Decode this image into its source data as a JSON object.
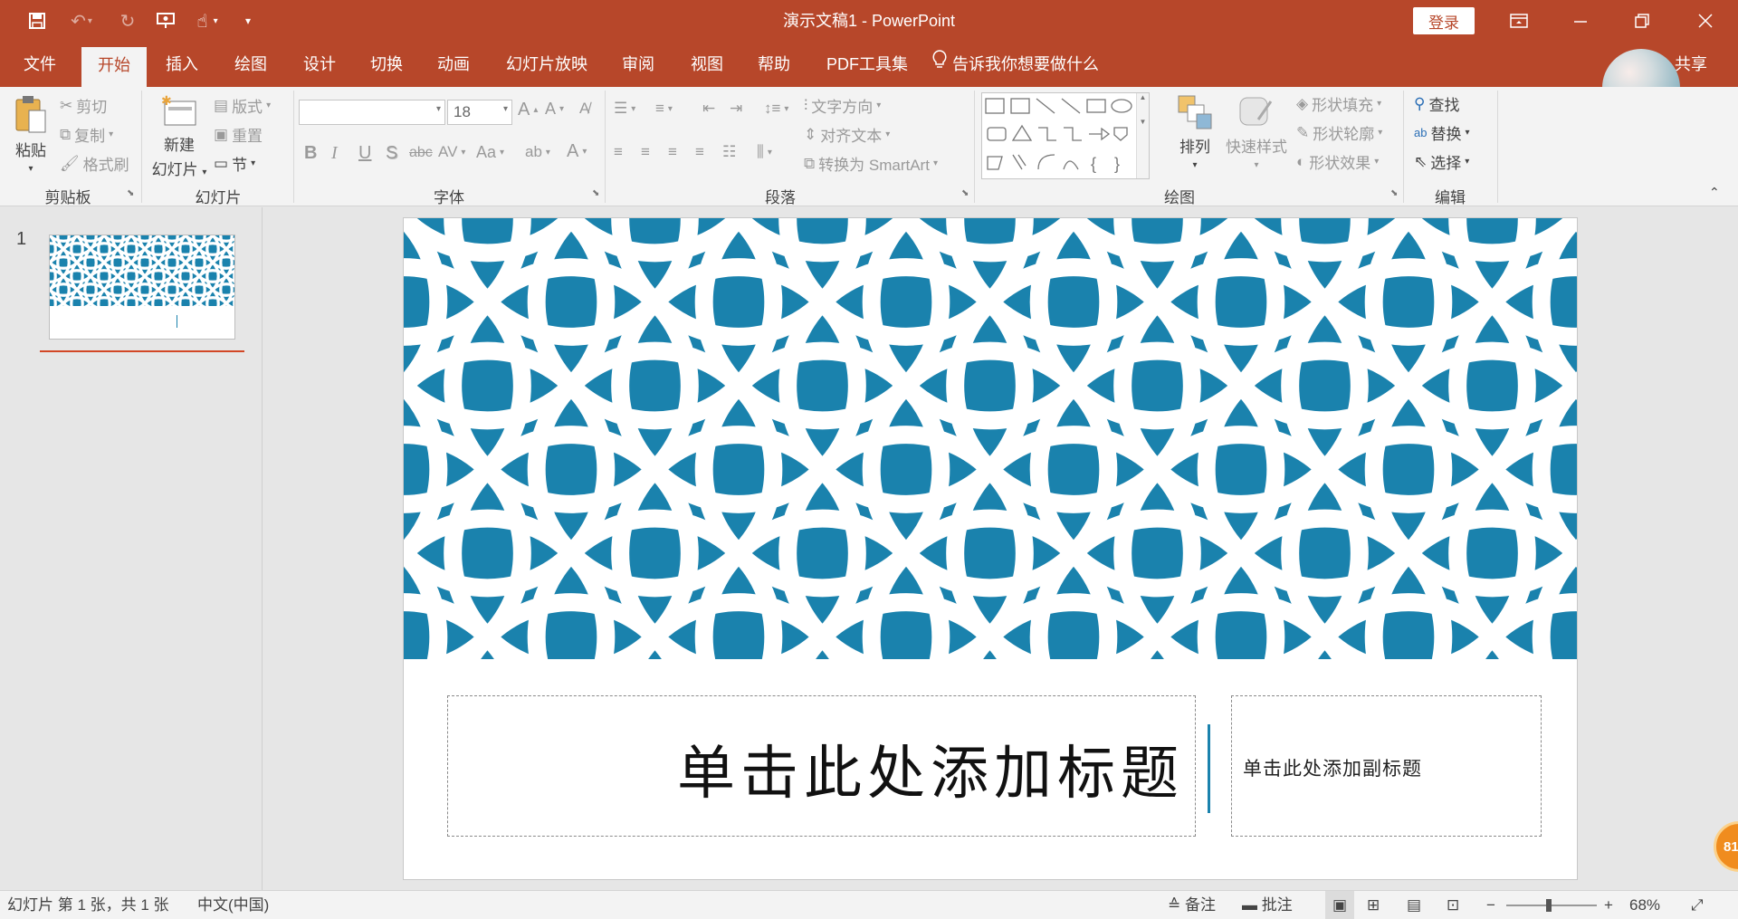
{
  "app": {
    "title": "演示文稿1  -  PowerPoint",
    "login": "登录",
    "share": "共享"
  },
  "colors": {
    "accent": "#b7472a",
    "pattern": "#1a82ad"
  },
  "tabs": [
    {
      "label": "文件"
    },
    {
      "label": "开始"
    },
    {
      "label": "插入"
    },
    {
      "label": "绘图"
    },
    {
      "label": "设计"
    },
    {
      "label": "切换"
    },
    {
      "label": "动画"
    },
    {
      "label": "幻灯片放映"
    },
    {
      "label": "审阅"
    },
    {
      "label": "视图"
    },
    {
      "label": "帮助"
    },
    {
      "label": "PDF工具集"
    }
  ],
  "tell_me": "告诉我你想要做什么",
  "ribbon": {
    "clipboard": {
      "paste": "粘贴",
      "cut": "剪切",
      "copy": "复制",
      "format_painter": "格式刷",
      "label": "剪贴板"
    },
    "slides": {
      "new_slide_1": "新建",
      "new_slide_2": "幻灯片",
      "layout": "版式",
      "reset": "重置",
      "section": "节",
      "label": "幻灯片"
    },
    "font": {
      "size": "18",
      "label": "字体",
      "bold": "B",
      "italic": "I",
      "underline": "U",
      "shadow": "S",
      "strike": "abc",
      "spacing": "AV",
      "case": "Aa",
      "color": "A"
    },
    "paragraph": {
      "text_direction": "文字方向",
      "align_text": "对齐文本",
      "smartart": "转换为 SmartArt",
      "label": "段落"
    },
    "drawing": {
      "arrange": "排列",
      "quick_styles": "快速样式",
      "shape_fill": "形状填充",
      "shape_outline": "形状轮廓",
      "shape_effects": "形状效果",
      "label": "绘图"
    },
    "editing": {
      "find": "查找",
      "replace": "替换",
      "select": "选择",
      "label": "编辑"
    }
  },
  "thumbs": {
    "slide_number": "1"
  },
  "slide": {
    "title_placeholder": "单击此处添加标题",
    "subtitle_placeholder": "单击此处添加副标题"
  },
  "status": {
    "slide_info": "幻灯片 第 1 张，共 1 张",
    "language": "中文(中国)",
    "notes": "备注",
    "comments": "批注",
    "zoom": "68%"
  },
  "badge": "81"
}
